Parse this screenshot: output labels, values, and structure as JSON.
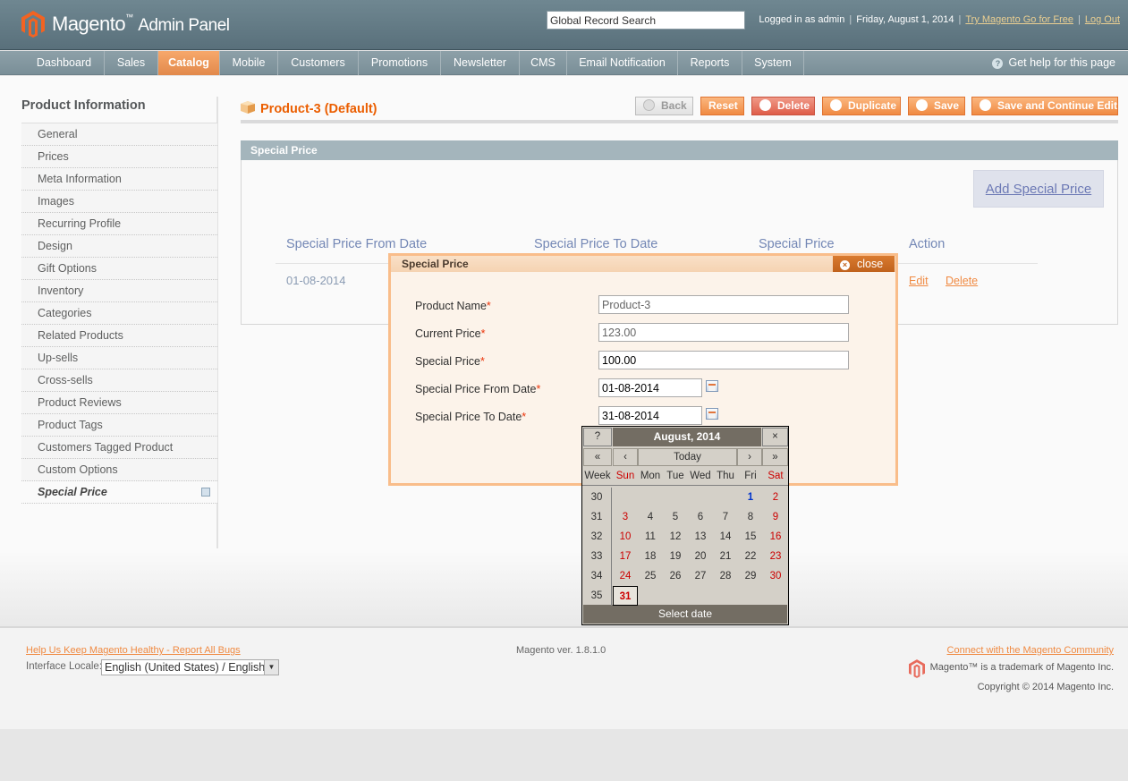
{
  "header": {
    "logo_text": "Magento",
    "logo_tm": "™",
    "logo_subtitle": "Admin Panel",
    "search_value": "Global Record Search",
    "logged_in": "Logged in as admin",
    "date": "Friday, August 1, 2014",
    "try_link": "Try Magento Go for Free",
    "logout": "Log Out"
  },
  "nav": {
    "items": [
      "Dashboard",
      "Sales",
      "Catalog",
      "Mobile",
      "Customers",
      "Promotions",
      "Newsletter",
      "CMS",
      "Email Notification",
      "Reports",
      "System"
    ],
    "active": "Catalog",
    "help": "Get help for this page"
  },
  "sidebar": {
    "title": "Product Information",
    "tabs": [
      "General",
      "Prices",
      "Meta Information",
      "Images",
      "Recurring Profile",
      "Design",
      "Gift Options",
      "Inventory",
      "Categories",
      "Related Products",
      "Up-sells",
      "Cross-sells",
      "Product Reviews",
      "Product Tags",
      "Customers Tagged Product",
      "Custom Options",
      "Special Price"
    ],
    "active_tab": "Special Price"
  },
  "page": {
    "title": "Product-3 (Default)",
    "buttons": {
      "back": "Back",
      "reset": "Reset",
      "delete": "Delete",
      "duplicate": "Duplicate",
      "save": "Save",
      "save_continue": "Save and Continue Edit"
    }
  },
  "section": {
    "title": "Special Price",
    "add_button": "Add Special Price",
    "columns": [
      "Special Price From Date",
      "Special Price To Date",
      "Special Price",
      "Action"
    ],
    "row": {
      "from_date": "01-08-2014",
      "edit": "Edit",
      "delete": "Delete"
    }
  },
  "dialog": {
    "title": "Special Price",
    "close": "close",
    "fields": {
      "product_name": {
        "label": "Product Name",
        "value": "Product-3"
      },
      "current_price": {
        "label": "Current Price",
        "value": "123.00"
      },
      "special_price": {
        "label": "Special Price",
        "value": "100.00"
      },
      "from_date": {
        "label": "Special Price From Date",
        "value": "01-08-2014"
      },
      "to_date": {
        "label": "Special Price To Date",
        "value": "31-08-2014"
      }
    },
    "required_mark": "*"
  },
  "calendar": {
    "help": "?",
    "title": "August, 2014",
    "close": "×",
    "nav": {
      "prev_year": "«",
      "prev_month": "‹",
      "today": "Today",
      "next_month": "›",
      "next_year": "»"
    },
    "weekday_header": [
      "Week",
      "Sun",
      "Mon",
      "Tue",
      "Wed",
      "Thu",
      "Fri",
      "Sat"
    ],
    "weeks": [
      {
        "week": "30",
        "days": [
          "",
          "",
          "",
          "",
          "",
          "1",
          "2"
        ]
      },
      {
        "week": "31",
        "days": [
          "3",
          "4",
          "5",
          "6",
          "7",
          "8",
          "9"
        ]
      },
      {
        "week": "32",
        "days": [
          "10",
          "11",
          "12",
          "13",
          "14",
          "15",
          "16"
        ]
      },
      {
        "week": "33",
        "days": [
          "17",
          "18",
          "19",
          "20",
          "21",
          "22",
          "23"
        ]
      },
      {
        "week": "34",
        "days": [
          "24",
          "25",
          "26",
          "27",
          "28",
          "29",
          "30"
        ]
      },
      {
        "week": "35",
        "days": [
          "31",
          "",
          "",
          "",
          "",
          "",
          ""
        ]
      }
    ],
    "selected_day": "1",
    "highlighted_day": "31",
    "footer": "Select date"
  },
  "footer": {
    "bug_link": "Help Us Keep Magento Healthy - Report All Bugs",
    "locale_label": "Interface Locale:",
    "locale_value": "English (United States) / English",
    "version": "Magento ver. 1.8.1.0",
    "community_link": "Connect with the Magento Community",
    "trademark": "Magento™ is a trademark of Magento Inc.",
    "copyright": "Copyright © 2014 Magento Inc."
  },
  "colors": {
    "accent": "#eb5e00",
    "header_bg": "#59707b",
    "nav_active": "#e2894b",
    "link_orange": "#f08a42"
  }
}
